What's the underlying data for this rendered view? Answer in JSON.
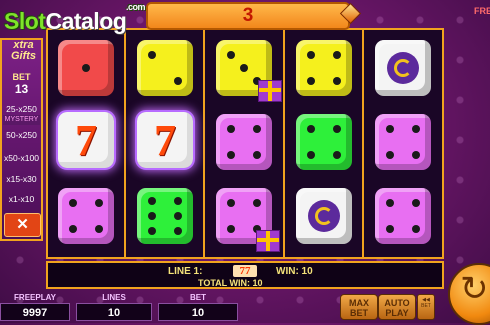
{
  "watermark": {
    "slot": "Slot",
    "catalog": "Catalog",
    "com": ".com"
  },
  "top_display": {
    "value": "3"
  },
  "side_panel": {
    "title_line1": "xtra",
    "title_line2": "Gifts",
    "bet_label": "BET",
    "bet_value": "13",
    "rows": [
      "25-x250",
      "MYSTERY",
      "50-x250",
      "x50-x100",
      "x15-x30",
      "x1-x10"
    ],
    "close_label": "✕"
  },
  "reels": [
    [
      "red-die-1",
      "seven",
      "magenta-die-4"
    ],
    [
      "yellow-die-2",
      "seven",
      "green-die-6"
    ],
    [
      "yellow-die-3",
      "magenta-die-4",
      "magenta-die-4"
    ],
    [
      "yellow-die-4",
      "green-die-4",
      "horseshoe"
    ],
    [
      "horseshoe",
      "magenta-die-4",
      "magenta-die-4"
    ]
  ],
  "winning_cells": [
    "reel1-row2",
    "reel2-row2"
  ],
  "info_bar": {
    "line_label": "LINE 1:",
    "line_symbol": "77",
    "win_label": "WIN: 10",
    "total_win_label": "TOTAL WIN: 10"
  },
  "bottom": {
    "freeplay_label": "FREEPLAY",
    "freeplay_value": "9997",
    "lines_label": "LINES",
    "lines_value": "10",
    "bet_label": "BET",
    "bet_value": "10"
  },
  "buttons": {
    "max_bet_line1": "MAX",
    "max_bet_line2": "BET",
    "auto_play_line1": "AUTO",
    "auto_play_line2": "PLAY",
    "small_button": "◀◀ BET"
  },
  "edge_text": "FRE"
}
